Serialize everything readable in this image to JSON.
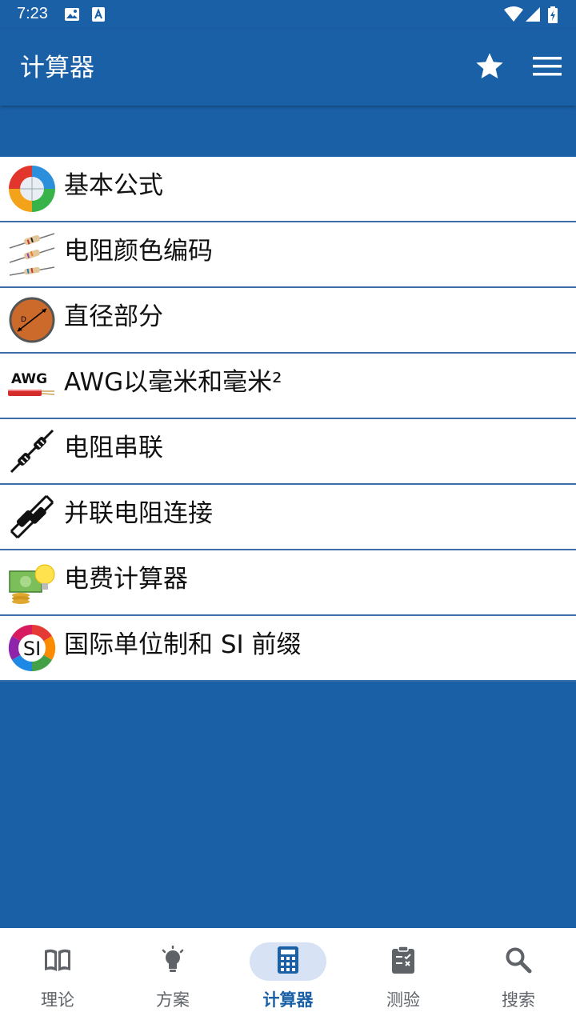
{
  "status_bar": {
    "time": "7:23"
  },
  "app_bar": {
    "title": "计算器",
    "icons": [
      "star-icon",
      "menu-icon"
    ]
  },
  "list": {
    "items": [
      {
        "label": "基本公式",
        "icon": "ohms-law-wheel-icon"
      },
      {
        "label": "电阻颜色编码",
        "icon": "resistor-color-code-icon"
      },
      {
        "label": "直径部分",
        "icon": "wire-diameter-icon"
      },
      {
        "label": "AWG以毫米和毫米²",
        "icon": "awg-wire-icon",
        "icon_text": "AWG"
      },
      {
        "label": "电阻串联",
        "icon": "resistors-series-icon"
      },
      {
        "label": "并联电阻连接",
        "icon": "resistors-parallel-icon"
      },
      {
        "label": "电费计算器",
        "icon": "electricity-cost-icon"
      },
      {
        "label": "国际单位制和 SI 前缀",
        "icon": "si-prefix-icon",
        "icon_text": "SI"
      }
    ]
  },
  "bottom_nav": {
    "items": [
      {
        "label": "理论",
        "icon": "book-icon",
        "active": false
      },
      {
        "label": "方案",
        "icon": "lightbulb-icon",
        "active": false
      },
      {
        "label": "计算器",
        "icon": "calculator-icon",
        "active": true
      },
      {
        "label": "测验",
        "icon": "clipboard-check-icon",
        "active": false
      },
      {
        "label": "搜索",
        "icon": "search-icon",
        "active": false
      }
    ]
  },
  "colors": {
    "primary": "#1a60a6",
    "nav_active_bg": "#d7e3f4",
    "divider": "#3d6da8"
  }
}
